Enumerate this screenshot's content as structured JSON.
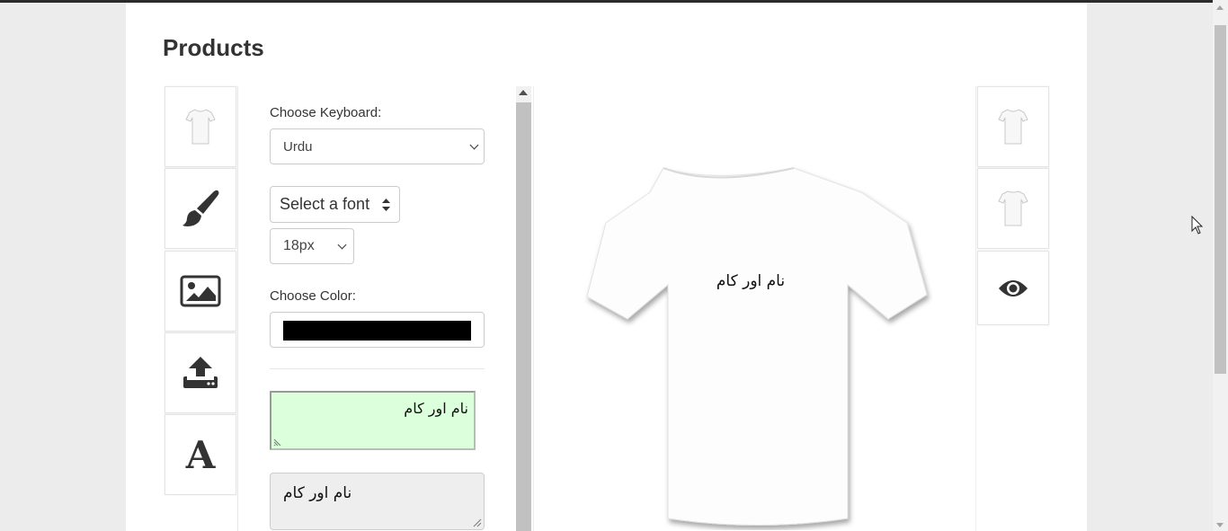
{
  "page": {
    "title": "Products"
  },
  "tools": [
    {
      "name": "tshirt-icon"
    },
    {
      "name": "paintbrush-icon"
    },
    {
      "name": "image-icon"
    },
    {
      "name": "upload-icon"
    },
    {
      "name": "text-icon",
      "glyph": "A"
    }
  ],
  "editor": {
    "keyboard_label": "Choose Keyboard:",
    "keyboard_value": "Urdu",
    "font_select_value": "Select a font",
    "font_size_value": "18px",
    "color_label": "Choose Color:",
    "color_value": "#000000",
    "urdu_input_text": "نام اور کام",
    "text_area_value": "نام اور کام"
  },
  "canvas": {
    "shirt_text": "نام اور کام"
  },
  "views": [
    {
      "name": "front-view-icon"
    },
    {
      "name": "back-view-icon"
    },
    {
      "name": "preview-eye-icon"
    }
  ]
}
